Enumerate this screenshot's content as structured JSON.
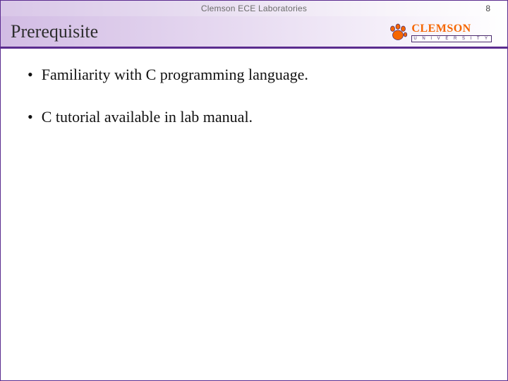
{
  "header": {
    "label": "Clemson ECE Laboratories",
    "page_number": "8"
  },
  "title": "Prerequisite",
  "brand": {
    "name": "CLEMSON",
    "subtitle": "U N I V E R S I T Y"
  },
  "bullets": [
    "Familiarity with C programming language.",
    "C tutorial available in lab manual."
  ]
}
